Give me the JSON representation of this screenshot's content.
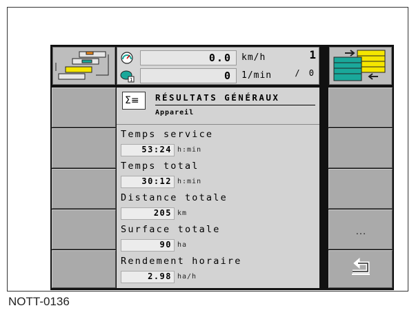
{
  "caption": "NOTT-0136",
  "topbar": {
    "speed_value": "0.0",
    "speed_unit": "km/h",
    "rpm_value": "0",
    "rpm_unit": "1/min",
    "rpm_icon_index": "1",
    "counter_top": "1",
    "counter_bottom": "/ 0"
  },
  "panel": {
    "title": "RÉSULTATS GÉNÉRAUX",
    "subtitle": "Appareil",
    "icon": "sigma-list-icon",
    "stats": [
      {
        "label": "Temps service",
        "value": "53:24",
        "unit": "h:min"
      },
      {
        "label": "Temps total",
        "value": "30:12",
        "unit": "h:min"
      },
      {
        "label": "Distance totale",
        "value": "205",
        "unit": "km"
      },
      {
        "label": "Surface totale",
        "value": "90",
        "unit": "ha"
      },
      {
        "label": "Rendement horaire",
        "value": "2.98",
        "unit": "ha/h"
      }
    ]
  },
  "softkeys": {
    "more_label": "...",
    "back_icon": "back-arrow-icon"
  },
  "colors": {
    "screen_bg": "#111111",
    "button_gray": "#aaaaaa",
    "panel_gray": "#d3d3d3",
    "icon_yellow": "#f5e600",
    "icon_teal": "#1aa89a",
    "icon_orange": "#e8871c"
  }
}
